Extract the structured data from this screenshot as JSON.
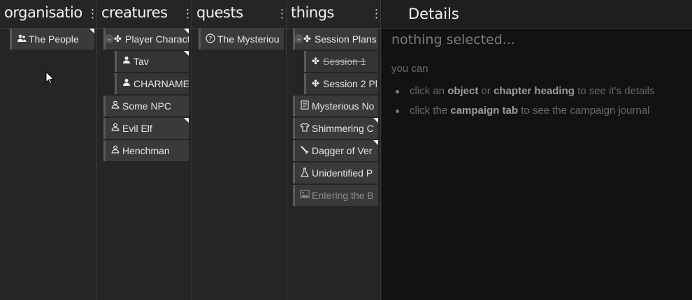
{
  "columns": {
    "organisations": {
      "title": "organisatio",
      "items": [
        {
          "label": "The People",
          "icon": "people-icon"
        }
      ]
    },
    "creatures": {
      "title": "creatures",
      "items": [
        {
          "label": "Player Charact",
          "icon": "puzzle-icon"
        },
        {
          "label": "Tav",
          "icon": "person-icon"
        },
        {
          "label": "CHARNAME",
          "icon": "person-icon"
        },
        {
          "label": "Some NPC",
          "icon": "person-outline-icon"
        },
        {
          "label": "Evil Elf",
          "icon": "person-outline-icon"
        },
        {
          "label": "Henchman",
          "icon": "person-outline-icon"
        }
      ]
    },
    "quests": {
      "title": "quests",
      "items": [
        {
          "label": "The Mysteriou",
          "icon": "question-circle-icon"
        }
      ]
    },
    "things": {
      "title": "things",
      "items": [
        {
          "label": "Session Plans",
          "icon": "puzzle-icon"
        },
        {
          "label": "Session 1",
          "icon": "puzzle-icon"
        },
        {
          "label": "Session 2 Pl",
          "icon": "puzzle-icon"
        },
        {
          "label": "Mysterious No",
          "icon": "document-icon"
        },
        {
          "label": "Shimmering C",
          "icon": "shirt-icon"
        },
        {
          "label": "Dagger of Ver",
          "icon": "dagger-icon"
        },
        {
          "label": "Unidentified P",
          "icon": "flask-icon"
        },
        {
          "label": "Entering the B",
          "icon": "image-icon"
        }
      ]
    }
  },
  "details": {
    "title": "Details",
    "empty_message": "nothing selected...",
    "intro": "you can",
    "hint1": {
      "pre": "click an ",
      "b1": "object",
      "mid": " or ",
      "b2": "chapter heading",
      "post": " to see it's details"
    },
    "hint2": {
      "pre": "click the ",
      "b1": "campaign tab",
      "post": " to see the campaign journal"
    }
  },
  "kebab_symbol": "⋮"
}
